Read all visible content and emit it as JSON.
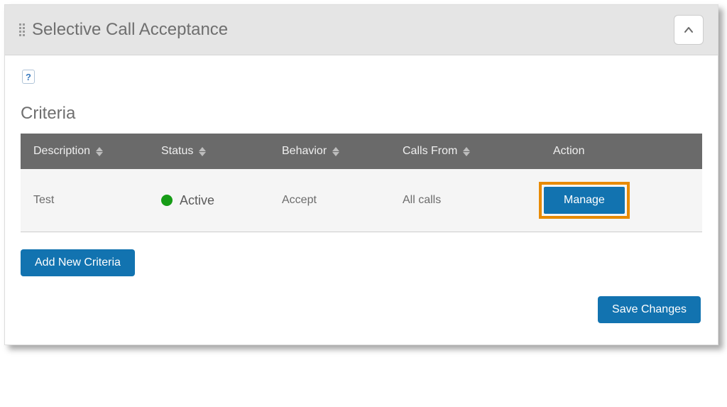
{
  "header": {
    "title": "Selective Call Acceptance"
  },
  "section": {
    "title": "Criteria"
  },
  "table": {
    "columns": {
      "description": "Description",
      "status": "Status",
      "behavior": "Behavior",
      "callsFrom": "Calls From",
      "action": "Action"
    },
    "rows": [
      {
        "description": "Test",
        "status_label": "Active",
        "status_state": "active",
        "behavior": "Accept",
        "callsFrom": "All calls",
        "action_label": "Manage"
      }
    ]
  },
  "buttons": {
    "addNew": "Add New Criteria",
    "save": "Save Changes"
  },
  "icons": {
    "help": "?"
  }
}
